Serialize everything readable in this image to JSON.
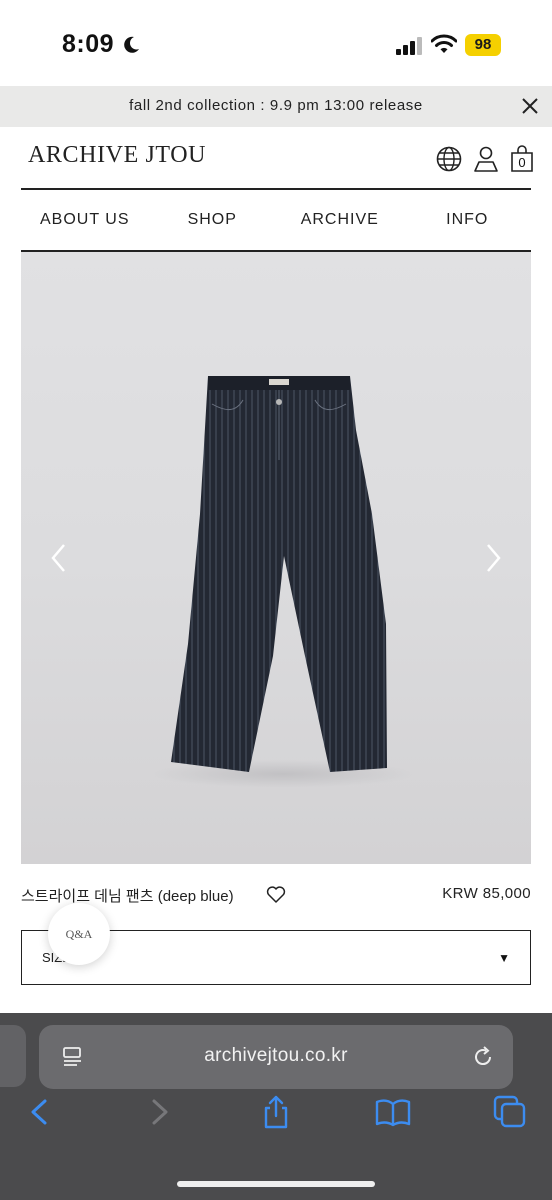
{
  "status": {
    "time": "8:09",
    "battery": "98"
  },
  "announcement": {
    "text": "fall 2nd collection : 9.9 pm 13:00 release"
  },
  "header": {
    "logo": "ARCHIVE JTOU",
    "cart_count": "0"
  },
  "nav": {
    "items": [
      "ABOUT US",
      "SHOP",
      "ARCHIVE",
      "INFO"
    ]
  },
  "product": {
    "name": "스트라이프 데님 팬츠 (deep blue)",
    "price": "KRW 85,000",
    "select_label": "SIZE",
    "qa_label": "Q&A"
  },
  "browser": {
    "url": "archivejtou.co.kr"
  },
  "icons": {
    "moon": "moon-icon",
    "signal": "cellular-signal-icon",
    "wifi": "wifi-icon",
    "close": "close-icon",
    "globe": "globe-icon",
    "user": "user-icon",
    "cart": "shopping-bag-icon",
    "prev": "chevron-left-icon",
    "next": "chevron-right-icon",
    "heart": "heart-icon",
    "reader": "reader-mode-icon",
    "reload": "reload-icon",
    "back": "back-icon",
    "forward": "forward-icon",
    "share": "share-icon",
    "bookmarks": "bookmarks-icon",
    "tabs": "tabs-icon"
  },
  "colors": {
    "battery": "#f5d000",
    "browser_accent": "#3c8cf0",
    "announce_bg": "#e9e9e8",
    "jeans": "#232833"
  }
}
